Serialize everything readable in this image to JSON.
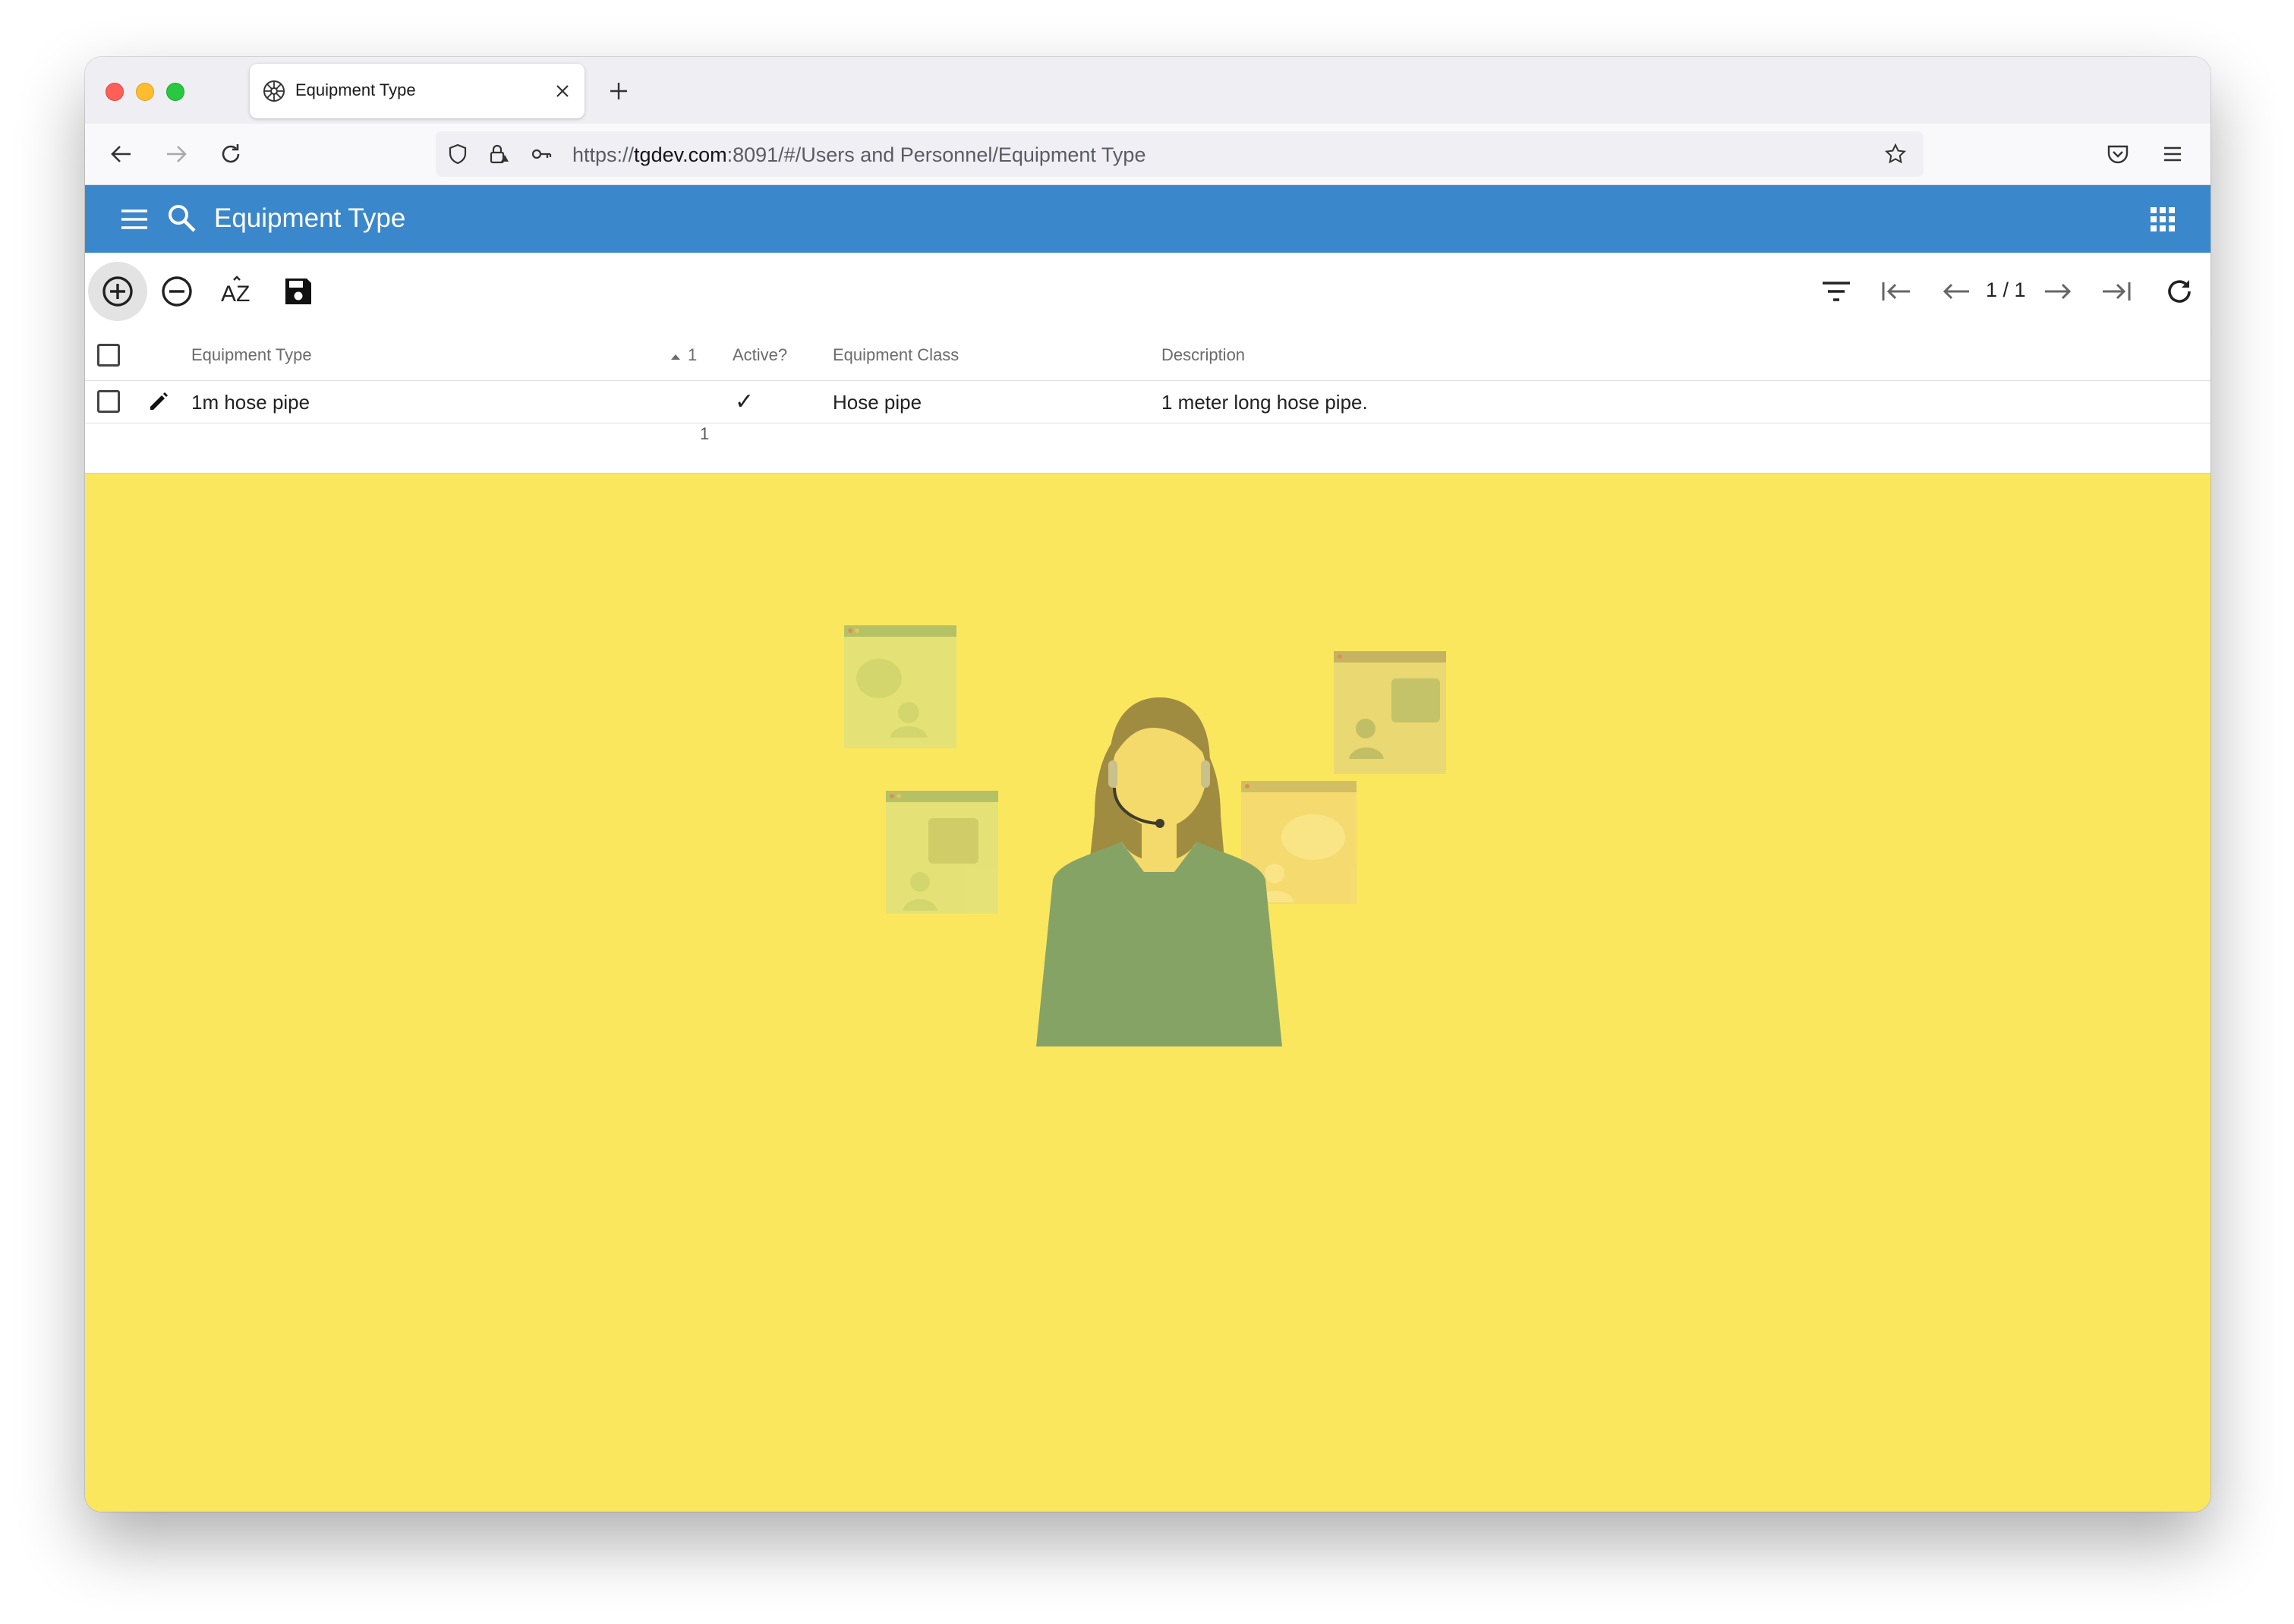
{
  "browser": {
    "tab_title": "Equipment Type",
    "url_scheme": "https://",
    "url_host": "tgdev.com",
    "url_rest": ":8091/#/Users and Personnel/Equipment Type"
  },
  "app": {
    "title": "Equipment Type",
    "header_color": "#3b87cb",
    "background_color": "#fbe75e"
  },
  "toolbar": {
    "icons": [
      "add-icon",
      "remove-icon",
      "sort-az-icon",
      "save-icon"
    ],
    "pager": "1 / 1"
  },
  "grid": {
    "columns": {
      "equipment_type": "Equipment Type",
      "sort_indicator": "1",
      "active": "Active?",
      "equipment_class": "Equipment Class",
      "description": "Description"
    },
    "rows": [
      {
        "equipment_type": "1m hose pipe",
        "active": true,
        "active_mark": "✓",
        "equipment_class": "Hose pipe",
        "description": "1 meter long hose pipe."
      }
    ],
    "footer_count": "1"
  }
}
